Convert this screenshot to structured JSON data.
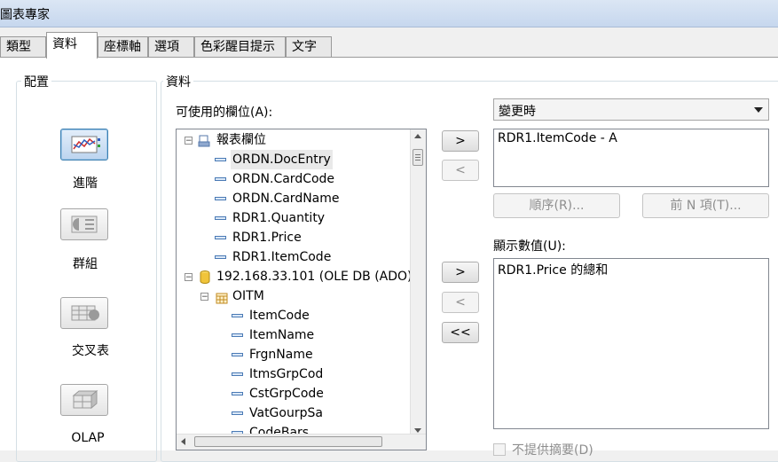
{
  "window": {
    "title": "圖表專家"
  },
  "tabs": [
    "類型",
    "資料",
    "座標軸",
    "選項",
    "色彩醒目提示",
    "文字"
  ],
  "layout_group": {
    "title": "配置",
    "items": [
      "進階",
      "群組",
      "交叉表",
      "OLAP"
    ]
  },
  "data_group": {
    "title": "資料"
  },
  "available_fields": {
    "label": "可使用的欄位(A):",
    "tree": [
      {
        "text": "報表欄位",
        "level": 0,
        "icon": "report-icon"
      },
      {
        "text": "ORDN.DocEntry",
        "level": 1,
        "icon": "field-icon",
        "highlighted": true
      },
      {
        "text": "ORDN.CardCode",
        "level": 1,
        "icon": "field-icon"
      },
      {
        "text": "ORDN.CardName",
        "level": 1,
        "icon": "field-icon"
      },
      {
        "text": "RDR1.Quantity",
        "level": 1,
        "icon": "field-icon"
      },
      {
        "text": "RDR1.Price",
        "level": 1,
        "icon": "field-icon"
      },
      {
        "text": "RDR1.ItemCode",
        "level": 1,
        "icon": "field-icon"
      },
      {
        "text": "192.168.33.101 (OLE DB (ADO)",
        "level": 0,
        "icon": "database-icon"
      },
      {
        "text": "OITM",
        "level": 1,
        "icon": "table-icon"
      },
      {
        "text": "ItemCode",
        "level": 2,
        "icon": "field-icon"
      },
      {
        "text": "ItemName",
        "level": 2,
        "icon": "field-icon"
      },
      {
        "text": "FrgnName",
        "level": 2,
        "icon": "field-icon"
      },
      {
        "text": "ItmsGrpCod",
        "level": 2,
        "icon": "field-icon"
      },
      {
        "text": "CstGrpCode",
        "level": 2,
        "icon": "field-icon"
      },
      {
        "text": "VatGourpSa",
        "level": 2,
        "icon": "field-icon"
      },
      {
        "text": "CodeBars",
        "level": 2,
        "icon": "field-icon"
      }
    ]
  },
  "arrows": {
    "add": ">",
    "remove": "<",
    "remove_all": "<<"
  },
  "on_change": {
    "selected": "變更時",
    "items": [
      "RDR1.ItemCode - A"
    ],
    "order_button": "順序(R)...",
    "topn_button": "前 N 項(T)..."
  },
  "show_values": {
    "label": "顯示數值(U):",
    "items": [
      "RDR1.Price 的總和"
    ]
  },
  "summary_checkbox": {
    "label": "不提供摘要(D)",
    "checked": false
  },
  "colors": {
    "accent": "#3c7fb1",
    "title_bar": "#c6d7ee"
  }
}
